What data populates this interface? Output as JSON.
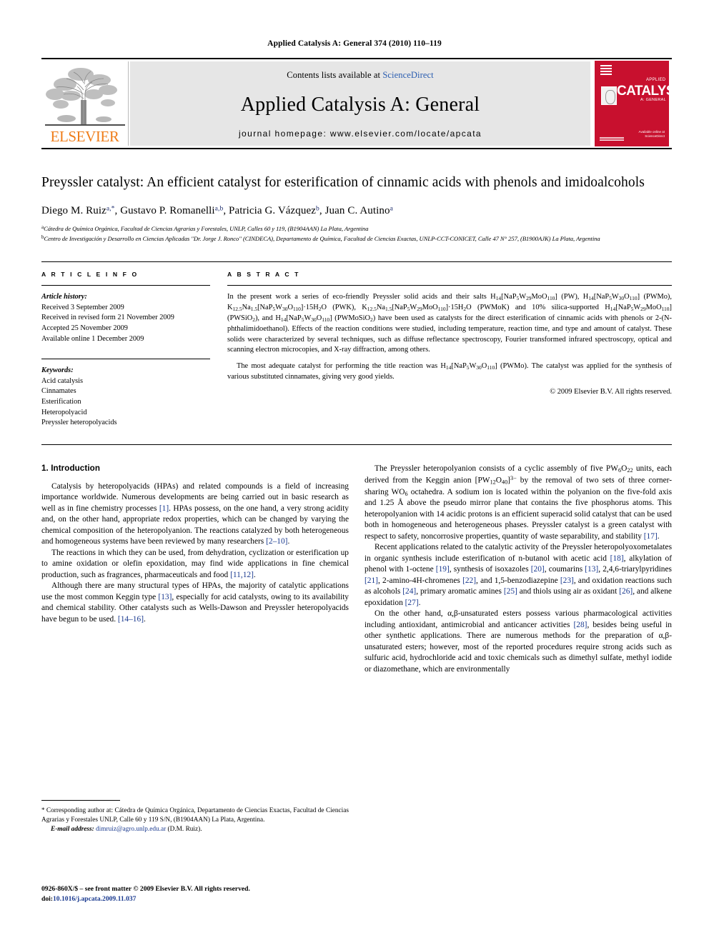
{
  "running_head": "Applied Catalysis A: General 374 (2010) 110–119",
  "masthead": {
    "contents_prefix": "Contents lists available at ",
    "sciencedirect": "ScienceDirect",
    "journal_title": "Applied Catalysis A: General",
    "homepage": "journal homepage: www.elsevier.com/locate/apcata",
    "publisher_name": "ELSEVIER",
    "publisher_color": "#ef7d1a",
    "cover": {
      "word": "CATALYSIS",
      "sup": "APPLIED",
      "sub": "A: GENERAL",
      "footer1": "Available online at",
      "footer2": "ScienceDirect",
      "color": "#c8102e"
    }
  },
  "article": {
    "title": "Preyssler catalyst: An efficient catalyst for esterification of cinnamic acids with phenols and imidoalcohols",
    "authors_parts": [
      {
        "name": "Diego M. Ruiz",
        "sup": "a,*"
      },
      {
        "name": "Gustavo P. Romanelli",
        "sup": "a,b"
      },
      {
        "name": "Patricia G. Vázquez",
        "sup": "b"
      },
      {
        "name": "Juan C. Autino",
        "sup": "a"
      }
    ],
    "affiliations": [
      {
        "marker": "a",
        "text": "Cátedra de Química Orgánica, Facultad de Ciencias Agrarias y Forestales, UNLP, Calles 60 y 119, (B1904AAN) La Plata, Argentina"
      },
      {
        "marker": "b",
        "text": "Centro de Investigación y Desarrollo en Ciencias Aplicadas \"Dr. Jorge J. Ronco\" (CINDECA), Departamento de Química, Facultad de Ciencias Exactas, UNLP-CCT-CONICET, Calle 47 N° 257, (B1900AJK) La Plata, Argentina"
      }
    ]
  },
  "article_info": {
    "label": "A R T I C L E  I N F O",
    "history_label": "Article history:",
    "history": [
      "Received 3 September 2009",
      "Received in revised form 21 November 2009",
      "Accepted 25 November 2009",
      "Available online 1 December 2009"
    ],
    "keywords_label": "Keywords:",
    "keywords": [
      "Acid catalysis",
      "Cinnamates",
      "Esterification",
      "Heteropolyacid",
      "Preyssler heteropolyacids"
    ]
  },
  "abstract": {
    "label": "A B S T R A C T",
    "paragraph1_html": "In the present work a series of eco-friendly Preyssler solid acids and their salts H<sub>14</sub>[NaP<sub>5</sub>W<sub>29</sub>MoO<sub>110</sub>] (PW), H<sub>14</sub>[NaP<sub>5</sub>W<sub>30</sub>O<sub>110</sub>] (PWMo), K<sub>12.5</sub>Na<sub>1.5</sub>[NaP<sub>5</sub>W<sub>30</sub>O<sub>110</sub>]·15H<sub>2</sub>O (PWK), K<sub>12.5</sub>Na<sub>1.5</sub>[NaP<sub>5</sub>W<sub>29</sub>MoO<sub>110</sub>]·15H<sub>2</sub>O (PWMoK) and 10% silica-supported H<sub>14</sub>[NaP<sub>5</sub>W<sub>29</sub>MoO<sub>110</sub>] (PWSiO<sub>2</sub>), and H<sub>14</sub>[NaP<sub>5</sub>W<sub>30</sub>O<sub>110</sub>] (PWMoSiO<sub>2</sub>) have been used as catalysts for the direct esterification of cinnamic acids with phenols or 2-(N-phthalimidoethanol). Effects of the reaction conditions were studied, including temperature, reaction time, and type and amount of catalyst. These solids were characterized by several techniques, such as diffuse reflectance spectroscopy, Fourier transformed infrared spectroscopy, optical and scanning electron microcopies, and X-ray diffraction, among others.",
    "paragraph2_html": "The most adequate catalyst for performing the title reaction was H<sub>14</sub>[NaP<sub>5</sub>W<sub>30</sub>O<sub>110</sub>] (PWMo). The catalyst was applied for the synthesis of various substituted cinnamates, giving very good yields.",
    "copyright": "© 2009 Elsevier B.V. All rights reserved."
  },
  "introduction": {
    "heading": "1. Introduction",
    "left_paragraphs_html": [
      "Catalysis by heteropolyacids (HPAs) and related compounds is a field of increasing importance worldwide. Numerous developments are being carried out in basic research as well as in fine chemistry processes <span class=\"ref\">[1]</span>. HPAs possess, on the one hand, a very strong acidity and, on the other hand, appropriate redox properties, which can be changed by varying the chemical composition of the heteropolyanion. The reactions catalyzed by both heterogeneous and homogeneous systems have been reviewed by many researchers <span class=\"ref\">[2–10]</span>.",
      "The reactions in which they can be used, from dehydration, cyclization or esterification up to amine oxidation or olefin epoxidation, may find wide applications in fine chemical production, such as fragrances, pharmaceuticals and food <span class=\"ref\">[11,12]</span>.",
      "Although there are many structural types of HPAs, the majority of catalytic applications use the most common Keggin type <span class=\"ref\">[13]</span>, especially for acid catalysts, owing to its availability and chemical stability. Other catalysts such as Wells-Dawson and Preyssler heteropolyacids have begun to be used. <span class=\"ref\">[14–16]</span>."
    ],
    "right_paragraphs_html": [
      "The Preyssler heteropolyanion consists of a cyclic assembly of five PW<sub>6</sub>O<sub>22</sub> units, each derived from the Keggin anion [PW<sub>12</sub>O<sub>40</sub>]<sup>3−</sup> by the removal of two sets of three corner-sharing WO<sub>6</sub> octahedra. A sodium ion is located within the polyanion on the five-fold axis and 1.25 Å above the pseudo mirror plane that contains the five phosphorus atoms. This heteropolyanion with 14 acidic protons is an efficient superacid solid catalyst that can be used both in homogeneous and heterogeneous phases. Preyssler catalyst is a green catalyst with respect to safety, noncorrosive properties, quantity of waste separability, and stability <span class=\"ref\">[17]</span>.",
      "Recent applications related to the catalytic activity of the Preyssler heteropolyoxometalates in organic synthesis include esterification of n-butanol with acetic acid <span class=\"ref\">[18]</span>, alkylation of phenol with 1-octene <span class=\"ref\">[19]</span>, synthesis of isoxazoles <span class=\"ref\">[20]</span>, coumarins <span class=\"ref\">[13]</span>, 2,4,6-triarylpyridines <span class=\"ref\">[21]</span>, 2-amino-4H-chromenes <span class=\"ref\">[22]</span>, and 1,5-benzodiazepine <span class=\"ref\">[23]</span>, and oxidation reactions such as alcohols <span class=\"ref\">[24]</span>, primary aromatic amines <span class=\"ref\">[25]</span> and thiols using air as oxidant <span class=\"ref\">[26]</span>, and alkene epoxidation <span class=\"ref\">[27]</span>.",
      "On the other hand, α,β-unsaturated esters possess various pharmacological activities including antioxidant, antimicrobial and anticancer activities <span class=\"ref\">[28]</span>, besides being useful in other synthetic applications. There are numerous methods for the preparation of α,β-unsaturated esters; however, most of the reported procedures require strong acids such as sulfuric acid, hydrochloride acid and toxic chemicals such as dimethyl sulfate, methyl iodide or diazomethane, which are environmentally"
    ]
  },
  "footnotes": {
    "corresponding_html": "<span class=\"star\">*</span> Corresponding author at: Cátedra de Química Orgánica, Departamento de Ciencias Exactas, Facultad de Ciencias Agrarias y Forestales UNLP, Calle 60 y 119 S/N, (B1904AAN) La Plata, Argentina.",
    "email_label": "E-mail address:",
    "email": "dimruiz@agro.unlp.edu.ar",
    "email_owner": "(D.M. Ruiz)."
  },
  "imprint": {
    "issn_line": "0926-860X/$ – see front matter © 2009 Elsevier B.V. All rights reserved.",
    "doi_label": "doi:",
    "doi": "10.1016/j.apcata.2009.11.037"
  }
}
